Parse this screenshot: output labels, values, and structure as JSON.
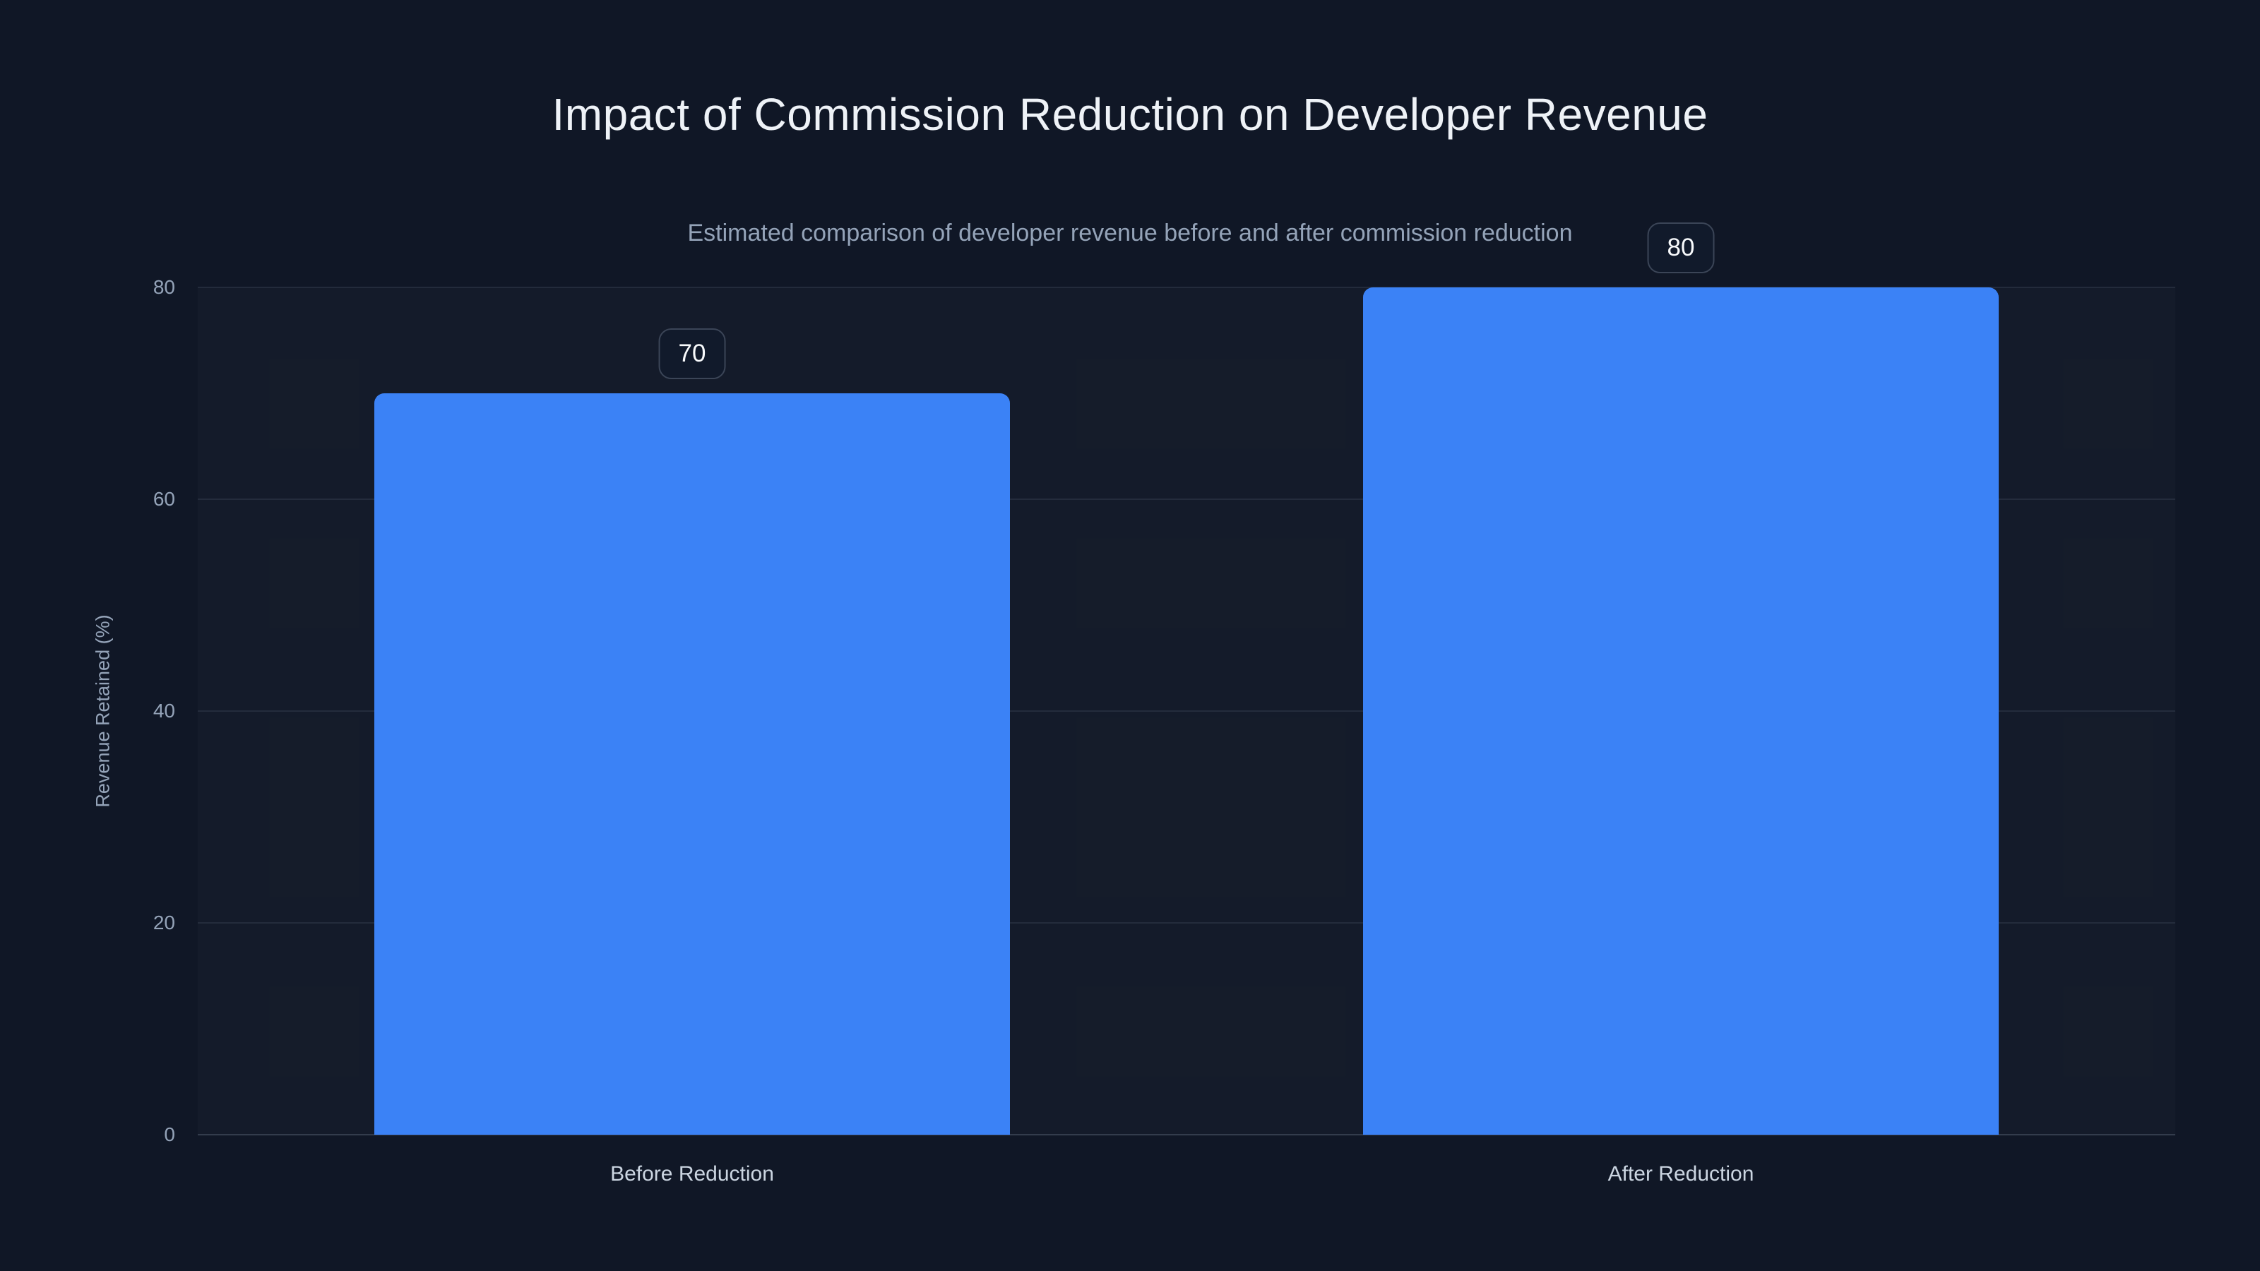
{
  "page": {
    "title": "Impact of Commission Reduction on Developer Revenue",
    "subtitle": "Estimated comparison of developer revenue before and after commission reduction"
  },
  "chart_data": {
    "type": "bar",
    "title": "Impact of Commission Reduction on Developer Revenue",
    "subtitle": "Estimated comparison of developer revenue before and after commission reduction",
    "categories": [
      "Before Reduction",
      "After Reduction"
    ],
    "values": [
      70,
      80
    ],
    "value_labels": [
      "70",
      "80"
    ],
    "xlabel": "",
    "ylabel": "Revenue Retained (%)",
    "ylim": [
      0,
      80
    ],
    "yticks": [
      0,
      20,
      40,
      60,
      80
    ],
    "grid": true,
    "legend": false,
    "bar_value_badges": true
  },
  "colors": {
    "background": "#101726",
    "plot_background": "rgba(255,255,255,0.02)",
    "bar": "#3b82f6",
    "gridline": "rgba(148,163,184,0.13)",
    "axis_line": "rgba(148,163,184,0.25)",
    "title_text": "#eef2f7",
    "subtitle_text": "#94a3b8",
    "tick_text": "#94a3b8",
    "category_text": "#cbd5e1",
    "badge_text": "#f8fafc",
    "badge_border": "#3b4557",
    "badge_background": "#111a2b"
  }
}
